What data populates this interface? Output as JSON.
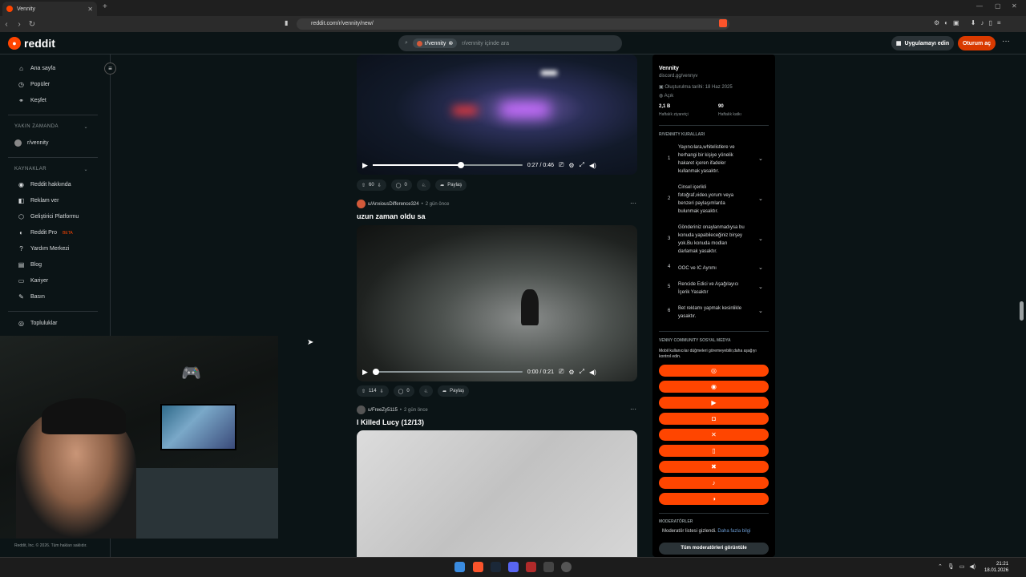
{
  "browser": {
    "tab_title": "Vennity",
    "url": "reddit.com/r/vennity/new/"
  },
  "header": {
    "logo_text": "reddit",
    "search_chip": "r/vennity",
    "search_placeholder": "r/vennity içinde ara",
    "app_button": "Uygulamayı edin",
    "login_button": "Oturum aç"
  },
  "sidebar": {
    "items_top": [
      {
        "label": "Ana sayfa",
        "icon": "home-icon"
      },
      {
        "label": "Popüler",
        "icon": "popular-icon"
      },
      {
        "label": "Keşfet",
        "icon": "explore-icon"
      }
    ],
    "recent_heading": "YAKIN ZAMANDA",
    "recent_items": [
      {
        "label": "r/vennity"
      }
    ],
    "resources_heading": "KAYNAKLAR",
    "resources": [
      {
        "label": "Reddit hakkında"
      },
      {
        "label": "Reklam ver"
      },
      {
        "label": "Geliştirici Platformu"
      },
      {
        "label": "Reddit Pro",
        "badge": "BETA"
      },
      {
        "label": "Yardım Merkezi"
      },
      {
        "label": "Blog"
      },
      {
        "label": "Kariyer"
      },
      {
        "label": "Basın"
      }
    ],
    "communities": "Topluluklar",
    "copyright": "Reddit, Inc. © 2026. Tüm hakları saklıdır."
  },
  "posts": [
    {
      "video": {
        "time": "0:27 / 0:46",
        "progress": 0.59
      },
      "votes": "60",
      "comments": "0",
      "share": "Paylaş"
    },
    {
      "author": "u/AnxiousDifference324",
      "time": "2 gün önce",
      "title": "uzun zaman oldu sa",
      "video": {
        "time": "0:00 / 0:21",
        "progress": 0.0
      },
      "votes": "114",
      "comments": "0",
      "share": "Paylaş"
    },
    {
      "author": "u/FreeZy5115",
      "time": "2 gün önce",
      "title": "I Killed Lucy (12/13)"
    }
  ],
  "community": {
    "name": "Vennity",
    "link": "discord.gg/vennyv",
    "created": "Oluşturulma tarihi: 18 Haz 2025",
    "visibility": "Açık",
    "stat1_value": "2,1 B",
    "stat1_label": "Haftalık ziyaretçi",
    "stat2_value": "90",
    "stat2_label": "Haftalık katkı",
    "rules_heading": "R/VENNITY KURALLARI",
    "rules": [
      {
        "num": "1",
        "text": "Yayıncılara,whitelistlere ve herhangi bir kişiye yönelik hakaret içeren ifadeler kullanmak yasaktır."
      },
      {
        "num": "2",
        "text": "Cinsel içerikli fotoğraf,video,yorum veya benzeri paylaşımlarda bulunmak yasaktır."
      },
      {
        "num": "3",
        "text": "Gönderiniz onaylanmadıysa bu konuda yapabileceğiniz birşey yok.Bu konuda modları darlamak yasaktır."
      },
      {
        "num": "4",
        "text": "OOC ve IC Ayrımı"
      },
      {
        "num": "5",
        "text": "Rencide Edici ve Aşağılayıcı İçerik Yasaktır"
      },
      {
        "num": "6",
        "text": "Bet reklamı yapmak kesinlikle yasaktır."
      }
    ],
    "social_heading": "VENNY COMMUNITY SOSYAL MEDYA",
    "social_note": "Mobil kullanıcılar düğmeleri göremeyebilir,daha aşağıyı kontrol edin.",
    "social_icons": [
      "web-icon",
      "discord-icon",
      "youtube-icon",
      "instagram-icon",
      "x-icon",
      "twitch-icon",
      "kick-icon",
      "tiktok-icon",
      "steam-icon"
    ],
    "mods_heading": "MODERATÖRLER",
    "mods_note": "Moderatör listesi gizlendi.",
    "mods_link": "Daha fazla bilgi",
    "mods_button": "Tüm moderatörleri görüntüle"
  },
  "taskbar": {
    "time": "21:21",
    "date": "18.01.2026"
  },
  "colors": {
    "accent": "#ff4500",
    "background": "#0b1416"
  }
}
